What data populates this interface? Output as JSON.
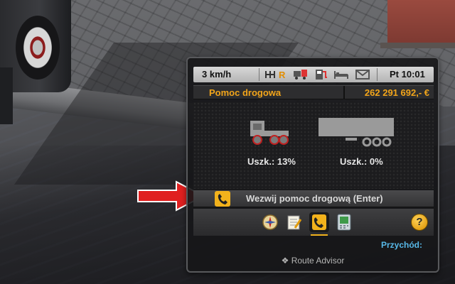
{
  "hud": {
    "speed": "3 km/h",
    "gear": "R",
    "clock": "Pt 10:01",
    "title": "Pomoc drogowa",
    "money": "262 291 692,- €",
    "truck_damage_label": "Uszk.: 13%",
    "trailer_damage_label": "Uszk.: 0%",
    "call_button_label": "Wezwij pomoc drogową (Enter)",
    "income_label": "Przychód:",
    "footer_label": "Route Advisor",
    "help_label": "?"
  },
  "colors": {
    "accent": "#f2a51a",
    "income": "#57b8e8",
    "arrow": "#e02020"
  },
  "icons": [
    "gear-shift-icon",
    "fuel-truck-icon",
    "fuel-pump-icon",
    "bed-icon",
    "mail-icon",
    "compass-tab-icon",
    "notepad-tab-icon",
    "phone-tab-icon",
    "device-tab-icon",
    "help-icon"
  ]
}
